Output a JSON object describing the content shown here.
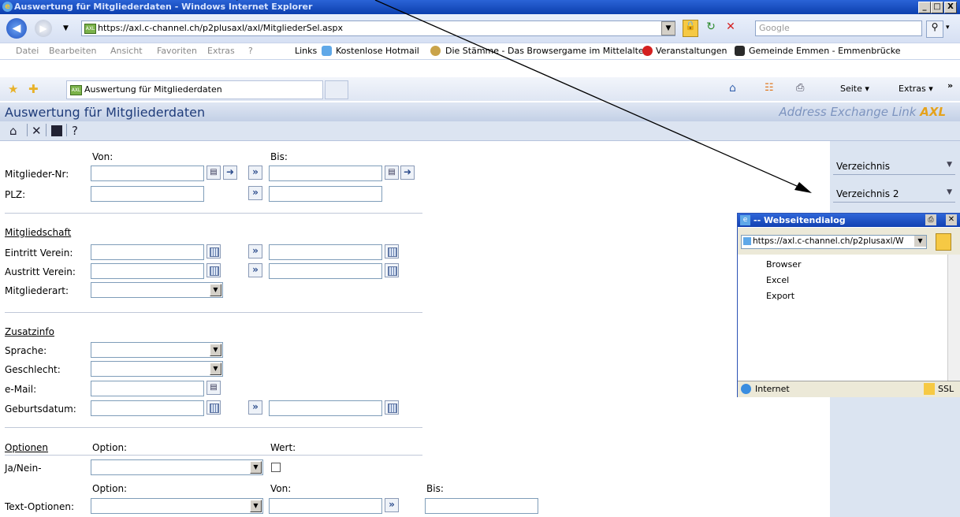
{
  "window": {
    "title": "Auswertung für Mitgliederdaten - Windows Internet Explorer",
    "url": "https://axl.c-channel.ch/p2plusaxl/axl/MitgliederSel.aspx",
    "search_placeholder": "Google",
    "controls": [
      "_",
      "□",
      "X"
    ]
  },
  "menu": {
    "items": [
      "Datei",
      "Bearbeiten",
      "Ansicht",
      "Favoriten",
      "Extras",
      "?"
    ],
    "links_label": "Links",
    "links": [
      "Kostenlose Hotmail",
      "Die Stämme - Das Browsergame im Mittelalter",
      "Veranstaltungen",
      "Gemeinde Emmen - Emmenbrücke"
    ]
  },
  "tab": {
    "label": "Auswertung für Mitgliederdaten",
    "tools": [
      "Seite ▾",
      "Extras ▾"
    ]
  },
  "page": {
    "title": "Auswertung für Mitgliederdaten",
    "brand_prefix": "Address Exchange Link",
    "brand_suffix": "AXL"
  },
  "form": {
    "von": "Von:",
    "bis": "Bis:",
    "mitglieder_nr": "Mitglieder-Nr:",
    "plz": "PLZ:",
    "sec_mitgliedschaft": "Mitgliedschaft",
    "eintritt": "Eintritt Verein:",
    "austritt": "Austritt Verein:",
    "mitgliederart": "Mitgliederart:",
    "sec_zusatzinfo": "Zusatzinfo",
    "sprache": "Sprache:",
    "geschlecht": "Geschlecht:",
    "email": "e-Mail:",
    "geburtsdatum": "Geburtsdatum:",
    "sec_optionen": "Optionen",
    "option": "Option:",
    "wert": "Wert:",
    "janein": "Ja/Nein-",
    "option2": "Option:",
    "von2": "Von:",
    "bis2": "Bis:",
    "textopt": "Text-Optionen:"
  },
  "sidebar": {
    "select1": "Verzeichnis",
    "select2": "Verzeichnis 2"
  },
  "dialog": {
    "title": "-- Webseitendialog",
    "url": "https://axl.c-channel.ch/p2plusaxl/W",
    "items": [
      "Browser",
      "Excel",
      "Export"
    ],
    "status": "Internet",
    "ssl": "SSL"
  },
  "colors": {
    "titlebar": "#0c3fae",
    "sidebar": "#dbe4f1",
    "brand_accent": "#e5a21c"
  }
}
